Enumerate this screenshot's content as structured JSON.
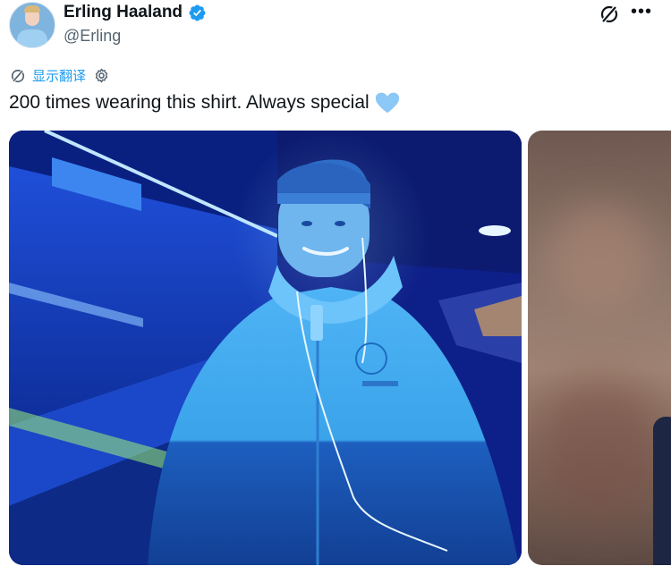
{
  "author": {
    "display_name": "Erling Haaland",
    "handle": "@Erling",
    "verified": true,
    "avatar_icon": "profile-photo"
  },
  "actions": {
    "grok_icon": "grok-icon",
    "more_label": "•••"
  },
  "translate": {
    "label": "显示翻译",
    "icon": "translate-icon",
    "settings_icon": "gear-icon"
  },
  "tweet": {
    "text": "200 times wearing this shirt. Always special",
    "emoji": "light-blue-heart"
  },
  "colors": {
    "accent": "#1d9bf0",
    "secondary_text": "#536471",
    "heart": "#8cc8f5"
  }
}
